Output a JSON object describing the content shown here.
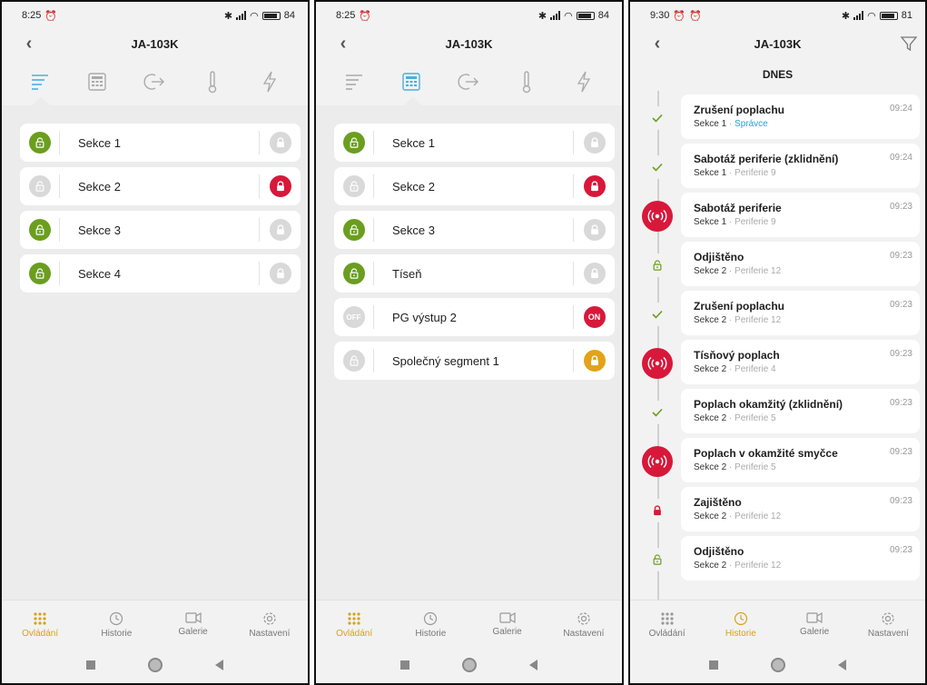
{
  "screen1": {
    "status": {
      "time": "8:25",
      "battery": "84"
    },
    "title": "JA-103K",
    "sections": [
      {
        "label": "Sekce 1",
        "lead": "green",
        "trail": "gray"
      },
      {
        "label": "Sekce 2",
        "lead": "gray",
        "trail": "red"
      },
      {
        "label": "Sekce 3",
        "lead": "green",
        "trail": "gray"
      },
      {
        "label": "Sekce 4",
        "lead": "green",
        "trail": "gray"
      }
    ],
    "nav_active": "ovladani"
  },
  "screen2": {
    "status": {
      "time": "8:25",
      "battery": "84"
    },
    "title": "JA-103K",
    "sections": [
      {
        "label": "Sekce 1",
        "lead": "green",
        "trail": "gray"
      },
      {
        "label": "Sekce 2",
        "lead": "gray",
        "trail": "red"
      },
      {
        "label": "Sekce 3",
        "lead": "green",
        "trail": "gray"
      },
      {
        "label": "Tíseň",
        "lead": "green",
        "trail": "gray"
      },
      {
        "label": "PG výstup 2",
        "lead": "off",
        "trail": "on"
      },
      {
        "label": "Společný segment 1",
        "lead": "gray",
        "trail": "amber"
      }
    ],
    "pg_off": "OFF",
    "pg_on": "ON",
    "nav_active": "ovladani"
  },
  "screen3": {
    "status": {
      "time": "9:30",
      "battery": "81"
    },
    "title": "JA-103K",
    "day": "DNES",
    "events": [
      {
        "title": "Zrušení poplachu",
        "section": "Sekce 1",
        "detail": "Správce",
        "time": "09:24",
        "marker": "check",
        "detail_type": "user"
      },
      {
        "title": "Sabotáž periferie (zklidnění)",
        "section": "Sekce 1",
        "detail": "Periferie 9",
        "time": "09:24",
        "marker": "check",
        "detail_type": "device"
      },
      {
        "title": "Sabotáž periferie",
        "section": "Sekce 1",
        "detail": "Periferie 9",
        "time": "09:23",
        "marker": "alarm",
        "detail_type": "device"
      },
      {
        "title": "Odjištěno",
        "section": "Sekce 2",
        "detail": "Periferie 12",
        "time": "09:23",
        "marker": "unlock",
        "detail_type": "device"
      },
      {
        "title": "Zrušení poplachu",
        "section": "Sekce 2",
        "detail": "Periferie 12",
        "time": "09:23",
        "marker": "check",
        "detail_type": "device"
      },
      {
        "title": "Tísňový poplach",
        "section": "Sekce 2",
        "detail": "Periferie 4",
        "time": "09:23",
        "marker": "alarm",
        "detail_type": "device"
      },
      {
        "title": "Poplach okamžitý (zklidnění)",
        "section": "Sekce 2",
        "detail": "Periferie 5",
        "time": "09:23",
        "marker": "check",
        "detail_type": "device"
      },
      {
        "title": "Poplach v okamžité smyčce",
        "section": "Sekce 2",
        "detail": "Periferie 5",
        "time": "09:23",
        "marker": "alarm",
        "detail_type": "device"
      },
      {
        "title": "Zajištěno",
        "section": "Sekce 2",
        "detail": "Periferie 12",
        "time": "09:23",
        "marker": "lock",
        "detail_type": "device"
      },
      {
        "title": "Odjištěno",
        "section": "Sekce 2",
        "detail": "Periferie 12",
        "time": "09:23",
        "marker": "unlock",
        "detail_type": "device"
      }
    ],
    "nav_active": "historie"
  },
  "nav_labels": {
    "ovladani": "Ovládání",
    "historie": "Historie",
    "galerie": "Galerie",
    "nastaveni": "Nastavení"
  },
  "detail_separator": "·",
  "colors": {
    "accent": "#d6a21a",
    "armed_red": "#d8183a",
    "disarmed_green": "#6b9e1f",
    "blue_active": "#4ab0e0",
    "amber": "#e3a21a"
  }
}
